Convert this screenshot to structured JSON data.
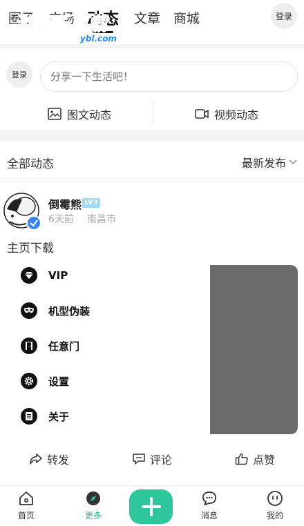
{
  "topnav": {
    "tabs": [
      {
        "label": "圈子"
      },
      {
        "label": "广场"
      },
      {
        "label": "动态"
      },
      {
        "label": "文章"
      },
      {
        "label": "商城"
      }
    ],
    "login_label": "登录",
    "watermark": {
      "main": "游吧乐下载",
      "sub": "ybl.com"
    }
  },
  "compose": {
    "login_label": "登录",
    "placeholder": "分享一下生活吧！",
    "photo_post_label": "图文动态",
    "video_post_label": "视频动态"
  },
  "feed": {
    "title": "全部动态",
    "sort_label": "最新发布"
  },
  "post": {
    "username": "倒霉熊",
    "level": "LV3",
    "time_ago": "6天前",
    "location": "南昌市",
    "text": "主页下载",
    "menu": [
      {
        "label": "VIP",
        "icon": "diamond-icon"
      },
      {
        "label": "机型伪装",
        "icon": "mask-icon"
      },
      {
        "label": "任意门",
        "icon": "door-icon"
      },
      {
        "label": "设置",
        "icon": "gear-icon"
      },
      {
        "label": "关于",
        "icon": "document-icon"
      }
    ],
    "actions": {
      "forward": "转发",
      "comment": "评论",
      "like": "点赞"
    }
  },
  "bottombar": {
    "home": "首页",
    "more": "更多",
    "messages": "消息",
    "mine": "我的"
  },
  "colors": {
    "accent": "#2ec79b",
    "verified": "#3b82f6",
    "level_badge": "#9fd8f0",
    "gray_panel": "#6b6b6b"
  }
}
